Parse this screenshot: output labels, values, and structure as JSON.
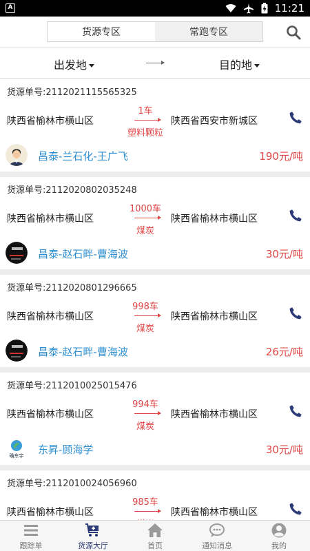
{
  "statusbar": {
    "time": "11:21",
    "app_icon_letter": "A"
  },
  "header": {
    "tabs": [
      {
        "label": "货源专区",
        "active": true
      },
      {
        "label": "常跑专区",
        "active": false
      }
    ],
    "search_icon": "search-icon"
  },
  "filter": {
    "origin_label": "出发地",
    "destination_label": "目的地"
  },
  "listings": [
    {
      "no": "货源单号:2112021115565325",
      "from": "陕西省榆林市横山区",
      "qty": "1车",
      "cargo": "塑料颗粒",
      "to": "陕西省西安市新城区",
      "owner": "昌泰-兰石化-王广飞",
      "price": "190元/吨",
      "avatar": "person"
    },
    {
      "no": "货源单号:2112020802035248",
      "from": "陕西省榆林市横山区",
      "qty": "1000车",
      "cargo": "煤炭",
      "to": "陕西省榆林市横山区",
      "owner": "昌泰-赵石畔-曹海波",
      "price": "30元/吨",
      "avatar": "dark"
    },
    {
      "no": "货源单号:2112020801296665",
      "from": "陕西省榆林市横山区",
      "qty": "998车",
      "cargo": "煤炭",
      "to": "陕西省榆林市横山区",
      "owner": "昌泰-赵石畔-曹海波",
      "price": "26元/吨",
      "avatar": "dark"
    },
    {
      "no": "货源单号:2112010025015476",
      "from": "陕西省榆林市横山区",
      "qty": "994车",
      "cargo": "煤炭",
      "to": "陕西省榆林市横山区",
      "owner": "东昇-顾海学",
      "price": "30元/吨",
      "avatar": "logo",
      "avatar_text": "确东宇"
    },
    {
      "no": "货源单号:2112010024056960",
      "from": "陕西省榆林市横山区",
      "qty": "985车",
      "cargo": "煤炭",
      "to": "陕西省榆林市横山区",
      "owner": "",
      "price": "",
      "avatar": ""
    }
  ],
  "bottom_nav": [
    {
      "label": "跟踪单",
      "icon": "list-icon",
      "active": false
    },
    {
      "label": "货源大厅",
      "icon": "cart-plus-icon",
      "active": true
    },
    {
      "label": "首页",
      "icon": "home-icon",
      "active": false
    },
    {
      "label": "通知消息",
      "icon": "chat-icon",
      "active": false
    },
    {
      "label": "我的",
      "icon": "user-icon",
      "active": false
    }
  ],
  "colors": {
    "accent_red": "#e04545",
    "link_blue": "#2f8fd0",
    "nav_active": "#2c3a78",
    "phone_icon": "#2c3a78"
  }
}
